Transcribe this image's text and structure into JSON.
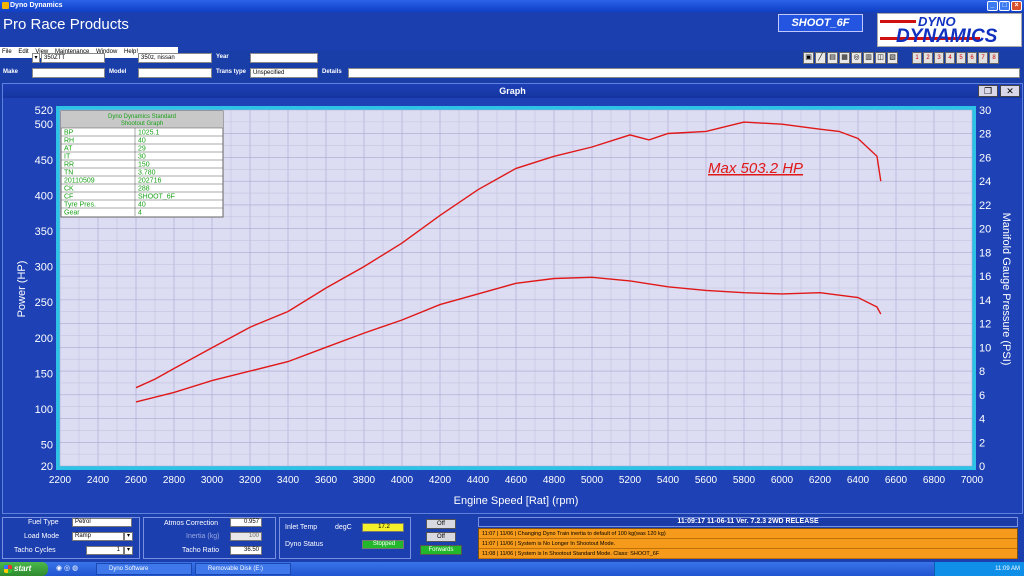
{
  "window": {
    "title": "Dyno Dynamics",
    "app_title": "Pro Race Products",
    "mode": "SHOOT_6F"
  },
  "logo": {
    "line1": "DYNO",
    "line2": "DYNAMICS"
  },
  "menu": [
    "File",
    "Edit",
    "View",
    "Maintenance",
    "Window",
    "Help!"
  ],
  "toolbar": {
    "number_buttons": [
      "1",
      "2",
      "3",
      "4",
      "5",
      "6",
      "7",
      "8"
    ]
  },
  "form": {
    "id_label": "ID",
    "id_value": "350ZTT",
    "customer_label": "Customer",
    "customer_value": "350z, nissan",
    "year_label": "Year",
    "year_value": "",
    "make_label": "Make",
    "make_value": "",
    "model_label": "Model",
    "model_value": "",
    "trans_label": "Trans type",
    "trans_value": "Unspecified",
    "details_label": "Details",
    "details_value": ""
  },
  "graph_window": {
    "title": "Graph",
    "restore_icon": "restore-icon",
    "close_icon": "close-icon"
  },
  "info_table": {
    "heading1": "Dyno Dynamics Standard",
    "heading2": "Shootout Graph",
    "rows": [
      [
        "BP",
        "1025.1"
      ],
      [
        "RH",
        "40"
      ],
      [
        "AT",
        "29"
      ],
      [
        "IT",
        "30"
      ],
      [
        "RR",
        "150"
      ],
      [
        "TN",
        "3.780"
      ],
      [
        "20110509",
        "202716"
      ],
      [
        "CK",
        "288"
      ],
      [
        "CF",
        "SHOOT_6F"
      ],
      [
        "Tyre Pres.",
        "40"
      ],
      [
        "Gear",
        "4"
      ]
    ]
  },
  "chart_data": {
    "type": "line",
    "annotation": "Max 503.2 HP",
    "xlabel": "Engine Speed [Rat] (rpm)",
    "ylabel": "Power (HP)",
    "y2label": "Manifold Gauge Pressure (PSI)",
    "xlim": [
      2200,
      7000
    ],
    "ylim": [
      20,
      520
    ],
    "y2lim": [
      0,
      30
    ],
    "x_ticks": [
      "2200",
      "2400",
      "2600",
      "2800",
      "3000",
      "3200",
      "3400",
      "3600",
      "3800",
      "4000",
      "4200",
      "4400",
      "4600",
      "4800",
      "5000",
      "5200",
      "5400",
      "5600",
      "5800",
      "6000",
      "6200",
      "6400",
      "6600",
      "6800",
      "7000"
    ],
    "y_ticks": [
      "20",
      "50",
      "100",
      "150",
      "200",
      "250",
      "300",
      "350",
      "400",
      "450",
      "500",
      "520"
    ],
    "y2_ticks": [
      "0",
      "2",
      "4",
      "6",
      "8",
      "10",
      "12",
      "14",
      "16",
      "18",
      "20",
      "22",
      "24",
      "26",
      "28",
      "30"
    ],
    "grid": true,
    "series": [
      {
        "color": "#e01818",
        "axis": "y",
        "x": [
          2600,
          2700,
          2800,
          3000,
          3200,
          3400,
          3600,
          3800,
          4000,
          4200,
          4400,
          4600,
          4800,
          5000,
          5200,
          5300,
          5400,
          5600,
          5800,
          6000,
          6200,
          6300,
          6400,
          6500,
          6520
        ],
        "y": [
          130,
          142,
          157,
          186,
          215,
          237,
          270,
          300,
          333,
          372,
          408,
          438,
          455,
          468,
          485,
          478,
          487,
          490,
          503,
          500,
          493,
          490,
          480,
          455,
          420
        ]
      },
      {
        "color": "#e01818",
        "axis": "y2",
        "x": [
          2600,
          2800,
          3000,
          3200,
          3400,
          3600,
          3800,
          4000,
          4200,
          4400,
          4600,
          4800,
          5000,
          5200,
          5400,
          5600,
          5800,
          6000,
          6200,
          6400,
          6500,
          6520
        ],
        "y": [
          5.4,
          6.2,
          7.2,
          8.0,
          8.8,
          10.0,
          11.2,
          12.3,
          13.6,
          14.5,
          15.4,
          15.8,
          15.9,
          15.6,
          15.1,
          14.8,
          14.6,
          14.5,
          14.6,
          14.2,
          13.4,
          12.8
        ]
      }
    ]
  },
  "bottom": {
    "fuel_label": "Fuel Type",
    "fuel_value": "Petrol",
    "load_label": "Load Mode",
    "load_value": "Ramp",
    "tacho_label": "Tacho Cycles",
    "tacho_value": "1",
    "atmos_label": "Atmos Correction",
    "atmos_value": "0.957",
    "inertia_label": "Inertia (kg)",
    "inertia_value": "100",
    "ratio_label": "Tacho Ratio",
    "ratio_value": "36.50",
    "inlet_label": "Inlet Temp",
    "inlet_unit": "degC",
    "inlet_value": "17.2",
    "dyno_label": "Dyno Status",
    "dyno_value": "Stopped",
    "off1": "Off",
    "off2": "Off",
    "direction": "Forwards"
  },
  "status": {
    "header": "11:09:17      11-06-11      Ver.  7.2.3 2WD RELEASE",
    "log": [
      "11:07 | 11/06 | Changing Dyno Train inertia to default of 100 kg(was 120 kg)",
      "11:07 | 11/06 | System is No Longer In Shootout Mode.",
      "11:08 | 11/06 | System is In Shootout Standard Mode. Class: SHOOT_6F"
    ]
  },
  "taskbar": {
    "start": "start",
    "tasks": [
      "Dyno Software",
      "Removable Disk (E:)"
    ],
    "clock": "11:09 AM"
  },
  "colors": {
    "plot_bg": "#dcdcf2",
    "frame": "#2ec3e6",
    "curve": "#e01818",
    "info_text": "#18a018"
  }
}
